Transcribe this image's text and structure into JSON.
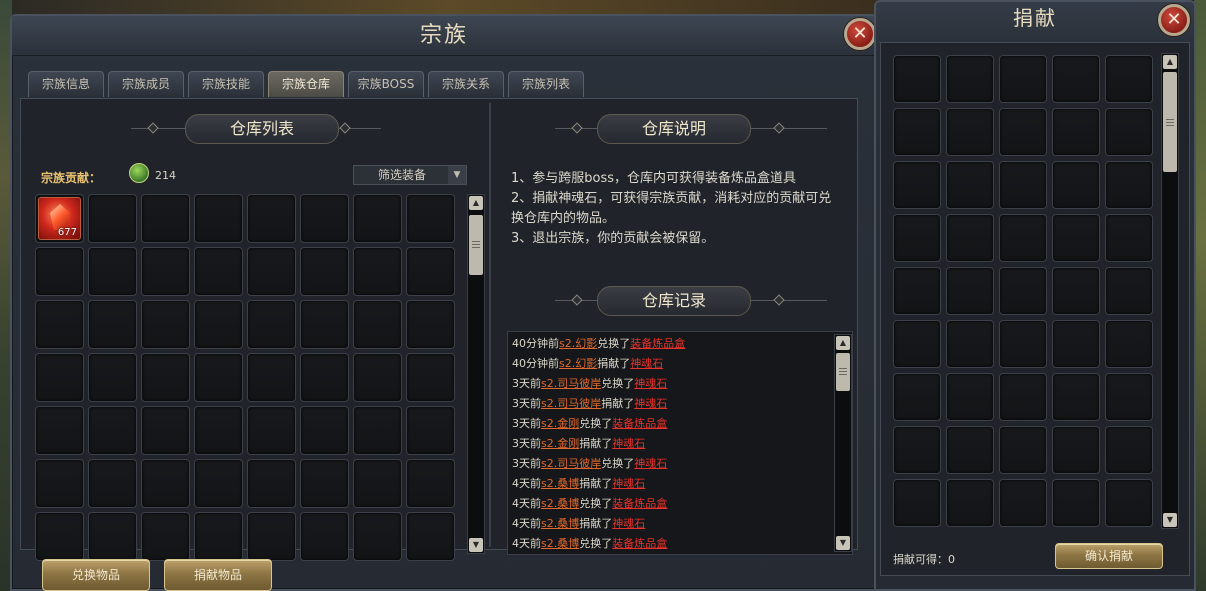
{
  "window": {
    "title": "宗族",
    "tabs": [
      "宗族信息",
      "宗族成员",
      "宗族技能",
      "宗族仓库",
      "宗族BOSS",
      "宗族关系",
      "宗族列表"
    ],
    "active_tab": "宗族仓库"
  },
  "warehouse": {
    "heading": "仓库列表",
    "contribution_label": "宗族贡献：",
    "contribution_value": "214",
    "filter_label": "筛选装备",
    "item": {
      "count": "677"
    }
  },
  "description": {
    "heading": "仓库说明",
    "lines": [
      "1、参与跨服boss，仓库内可获得装备炼品盒道具",
      "2、捐献神魂石，可获得宗族贡献，消耗对应的贡献可兑",
      "换仓库内的物品。",
      "3、退出宗族，你的贡献会被保留。"
    ]
  },
  "records": {
    "heading": "仓库记录",
    "entries": [
      {
        "time": "40分钟前",
        "user": "s2.幻影",
        "action": "兑换了",
        "item": "装备炼品盒"
      },
      {
        "time": "40分钟前",
        "user": "s2.幻影",
        "action": "捐献了",
        "item": "神魂石"
      },
      {
        "time": "3天前",
        "user": "s2.司马彼岸",
        "action": "兑换了",
        "item": "神魂石"
      },
      {
        "time": "3天前",
        "user": "s2.司马彼岸",
        "action": "捐献了",
        "item": "神魂石"
      },
      {
        "time": "3天前",
        "user": "s2.金刚",
        "action": "兑换了",
        "item": "装备炼品盒"
      },
      {
        "time": "3天前",
        "user": "s2.金刚",
        "action": "捐献了",
        "item": "神魂石"
      },
      {
        "time": "3天前",
        "user": "s2.司马彼岸",
        "action": "兑换了",
        "item": "神魂石"
      },
      {
        "time": "4天前",
        "user": "s2.桑博",
        "action": "捐献了",
        "item": "神魂石"
      },
      {
        "time": "4天前",
        "user": "s2.桑博",
        "action": "兑换了",
        "item": "装备炼品盒"
      },
      {
        "time": "4天前",
        "user": "s2.桑博",
        "action": "捐献了",
        "item": "神魂石"
      },
      {
        "time": "4天前",
        "user": "s2.桑博",
        "action": "兑换了",
        "item": "装备炼品盒"
      }
    ]
  },
  "buttons": {
    "exchange": "兑换物品",
    "donate": "捐献物品"
  },
  "donate_panel": {
    "title": "捐献",
    "obtainable_label": "捐献可得：",
    "obtainable_value": "0",
    "confirm": "确认捐献"
  },
  "icons": {
    "close": "close-icon",
    "contribution": "jade-coin-icon",
    "item": "red-crystal-icon"
  }
}
